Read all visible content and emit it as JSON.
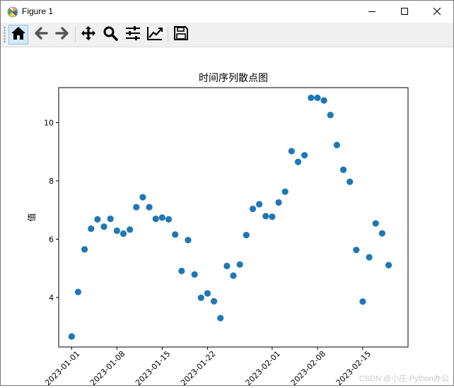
{
  "window": {
    "title": "Figure 1",
    "app_icon": "matplotlib-icon",
    "controls": [
      "minimize-icon",
      "maximize-icon",
      "close-icon"
    ]
  },
  "toolbar": {
    "tools": [
      {
        "name": "home",
        "icon": "home-icon"
      },
      {
        "name": "back",
        "icon": "arrow-left-icon"
      },
      {
        "name": "forward",
        "icon": "arrow-right-icon"
      },
      {
        "name": "pan",
        "icon": "move-icon"
      },
      {
        "name": "zoom",
        "icon": "zoom-icon"
      },
      {
        "name": "subplots",
        "icon": "sliders-icon"
      },
      {
        "name": "edit-axis",
        "icon": "line-chart-icon"
      },
      {
        "name": "save",
        "icon": "floppy-icon"
      }
    ]
  },
  "watermark": "CSDN @小庄-Python办公",
  "chart_data": {
    "type": "scatter",
    "title": "时间序列散点图",
    "xlabel": "",
    "ylabel": "值",
    "color": "#1f77b4",
    "grid": false,
    "xlim": [
      "2022-12-30",
      "2023-02-22"
    ],
    "ylim": [
      2.3,
      11.2
    ],
    "xticks": [
      "2023-01-01",
      "2023-01-08",
      "2023-01-15",
      "2023-01-22",
      "2023-02-01",
      "2023-02-08",
      "2023-02-15"
    ],
    "xtick_labels": [
      "2023-01-01",
      "2023-01-08",
      "2023-01-15",
      "2023-01-22",
      "2023-02-01",
      "2023-02-08",
      "2023-02-15"
    ],
    "yticks": [
      4,
      6,
      8,
      10
    ],
    "x": [
      "2023-01-01",
      "2023-01-02",
      "2023-01-03",
      "2023-01-04",
      "2023-01-05",
      "2023-01-06",
      "2023-01-07",
      "2023-01-08",
      "2023-01-09",
      "2023-01-10",
      "2023-01-11",
      "2023-01-12",
      "2023-01-13",
      "2023-01-14",
      "2023-01-15",
      "2023-01-16",
      "2023-01-17",
      "2023-01-18",
      "2023-01-19",
      "2023-01-20",
      "2023-01-21",
      "2023-01-22",
      "2023-01-23",
      "2023-01-24",
      "2023-01-25",
      "2023-01-26",
      "2023-01-27",
      "2023-01-28",
      "2023-01-29",
      "2023-01-30",
      "2023-01-31",
      "2023-02-01",
      "2023-02-02",
      "2023-02-03",
      "2023-02-04",
      "2023-02-05",
      "2023-02-06",
      "2023-02-07",
      "2023-02-08",
      "2023-02-09",
      "2023-02-10",
      "2023-02-11",
      "2023-02-12",
      "2023-02-13",
      "2023-02-14",
      "2023-02-15",
      "2023-02-16",
      "2023-02-17",
      "2023-02-18",
      "2023-02-19"
    ],
    "y": [
      2.66,
      4.19,
      5.65,
      6.36,
      6.68,
      6.43,
      6.7,
      6.29,
      6.19,
      6.33,
      7.1,
      7.44,
      7.1,
      6.7,
      6.74,
      6.68,
      6.16,
      4.91,
      5.97,
      4.79,
      3.99,
      4.14,
      3.87,
      3.29,
      5.08,
      4.75,
      5.13,
      6.14,
      7.04,
      7.2,
      6.79,
      6.77,
      7.26,
      7.63,
      9.02,
      8.65,
      8.88,
      10.85,
      10.85,
      10.76,
      10.26,
      9.23,
      8.38,
      7.97,
      5.63,
      3.86,
      5.38,
      6.54,
      6.2,
      5.11
    ]
  }
}
